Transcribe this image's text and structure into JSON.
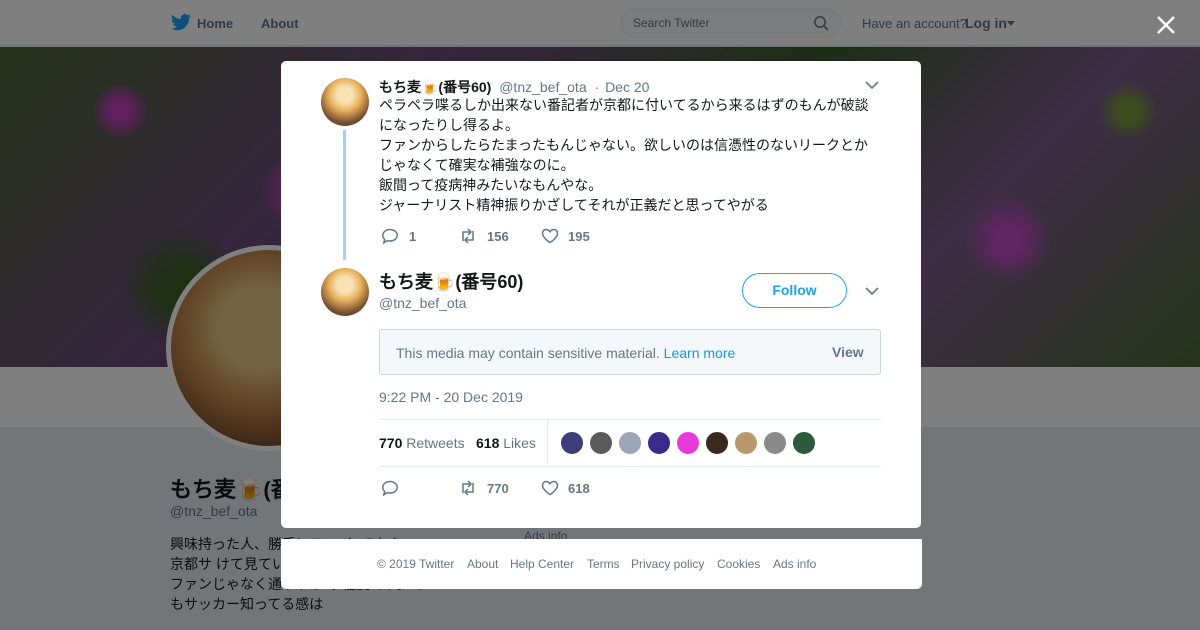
{
  "topbar": {
    "home_label": "Home",
    "about_label": "About",
    "search_placeholder": "Search Twitter",
    "have_account": "Have an account?",
    "login_label": "Log in"
  },
  "profile": {
    "name": "もち麦🍺(番",
    "handle": "@tnz_bef_ota",
    "bio": "興味持った人、勝手にフ ロ してます。 京都サ けて見ていますが いっす。てか、ファンじゃなく通りすが り程度です。でもサッカー知ってる感は",
    "ads_info": "Ads info"
  },
  "parent_tweet": {
    "name": "もち麦🍺(番号60)",
    "handle": "@tnz_bef_ota",
    "date": "Dec 20",
    "lines": [
      "ペラペラ喋るしか出来ない番記者が京都に付いてるから来るはずのもんが破談",
      "になったりし得るよ。",
      "ファンからしたらたまったもんじゃない。欲しいのは信憑性のないリークとか",
      "じゃなくて確実な補強なのに。",
      "飯間って疫病神みたいなもんやな。",
      "ジャーナリスト精神振りかざしてそれが正義だと思ってやがる"
    ],
    "replies": "1",
    "retweets": "156",
    "likes": "195"
  },
  "main_tweet": {
    "name": "もち麦🍺(番号60)",
    "handle": "@tnz_bef_ota",
    "follow_label": "Follow",
    "media_warning": "This media may contain sensitive material.",
    "learn_more": "Learn more",
    "view_label": "View",
    "timestamp": "9:22 PM - 20 Dec 2019",
    "retweet_count": "770",
    "retweets_label": "Retweets",
    "like_count": "618",
    "likes_label": "Likes",
    "bottom_retweets": "770",
    "bottom_likes": "618",
    "liker_colors": [
      "#3a3f7a",
      "#5a5a5a",
      "#9aa6b8",
      "#3a2a8a",
      "#e83ad8",
      "#3a2a1e",
      "#b89a6a",
      "#8a8a8a",
      "#2a5a3a"
    ]
  },
  "footer": {
    "links": [
      "© 2019 Twitter",
      "About",
      "Help Center",
      "Terms",
      "Privacy policy",
      "Cookies",
      "Ads info"
    ]
  },
  "colors": {
    "accent": "#1da1f2",
    "link": "#1b95e0",
    "muted": "#657786"
  }
}
